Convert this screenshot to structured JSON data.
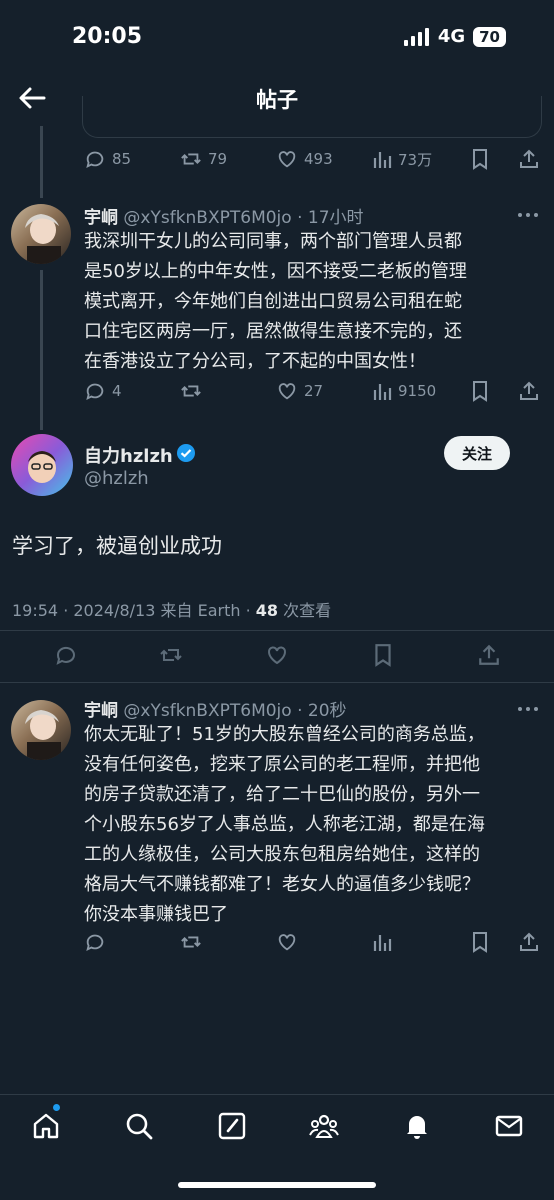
{
  "status": {
    "time": "20:05",
    "network": "4G",
    "battery": "70"
  },
  "header": {
    "title": "帖子"
  },
  "prev_actions": {
    "replies": "85",
    "retweets": "79",
    "likes": "493",
    "views": "73万"
  },
  "reply1": {
    "name": "宇峒",
    "handle": "@xYsfknBXPT6M0jo · 17小时",
    "lines": [
      "我深圳干女儿的公司同事，两个部门管理人员都",
      "是50岁以上的中年女性，因不接受二老板的管理",
      "模式离开，今年她们自创进出口贸易公司租在蛇",
      "口住宅区两房一厅，居然做得生意接不完的，还",
      "在香港设立了分公司，了不起的中国女性！"
    ],
    "replies": "4",
    "retweets": "",
    "likes": "27",
    "views": "9150"
  },
  "main": {
    "name": "自力hzlzh",
    "handle": "@hzlzh",
    "follow_label": "关注",
    "text": "学习了，被逼创业成功",
    "meta_prefix": "19:54 · 2024/8/13 来自 Earth · ",
    "views_count": "48",
    "views_suffix": " 次查看"
  },
  "reply2": {
    "name": "宇峒",
    "handle": "@xYsfknBXPT6M0jo · 20秒",
    "lines": [
      "你太无耻了！51岁的大股东曾经公司的商务总监，",
      "没有任何姿色，挖来了原公司的老工程师，并把他",
      "的房子贷款还清了，给了二十巴仙的股份，另外一",
      "个小股东56岁了人事总监，人称老江湖，都是在海",
      "工的人缘极佳，公司大股东包租房给她住，这样的",
      "格局大气不赚钱都难了！老女人的逼值多少钱呢？",
      "你没本事赚钱巴了"
    ]
  },
  "nav": [
    "home-icon",
    "search-icon",
    "compose-icon",
    "communities-icon",
    "notifications-icon",
    "messages-icon"
  ],
  "colors": {
    "background": "#15202b",
    "accent": "#1d9bf0",
    "muted": "#8b98a5"
  }
}
